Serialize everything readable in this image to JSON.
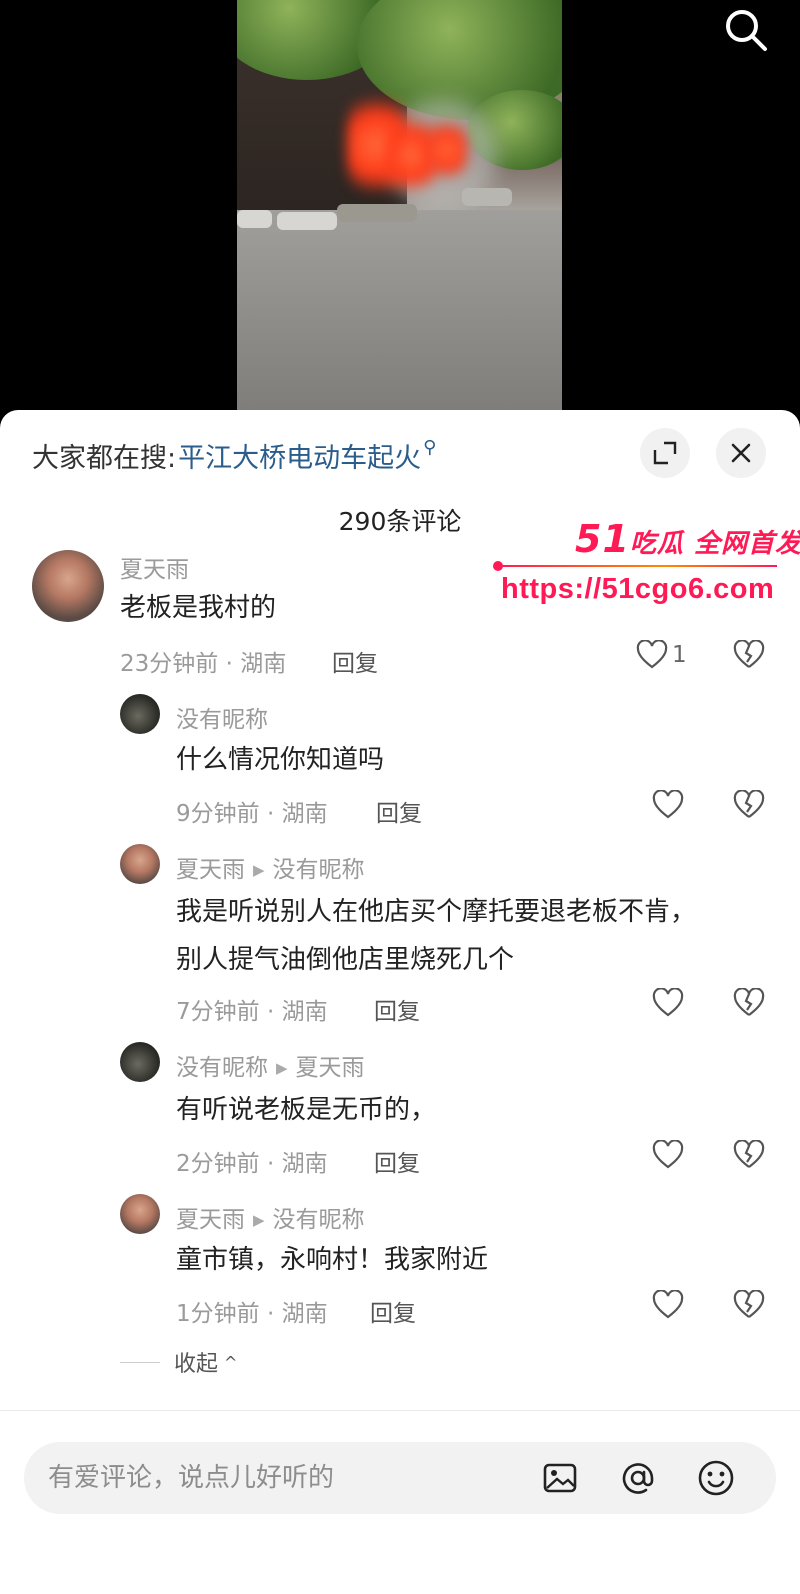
{
  "video": {
    "search_icon": "search-icon"
  },
  "header": {
    "search_prefix": "大家都在搜:",
    "search_term": "平江大桥电动车起火",
    "expand_icon": "expand-icon",
    "close_icon": "close-icon"
  },
  "comment_count": "290条评论",
  "comments": [
    {
      "name": "夏天雨",
      "text": "老板是我村的",
      "time_location": "23分钟前 · 湖南",
      "reply": "回复",
      "likes": "1"
    }
  ],
  "replies": [
    {
      "name": "没有昵称",
      "reply_to": "",
      "lines": [
        "什么情况你知道吗"
      ],
      "time_location": "9分钟前 · 湖南",
      "reply": "回复"
    },
    {
      "name": "夏天雨",
      "reply_to": "没有昵称",
      "lines": [
        "我是听说别人在他店买个摩托要退老板不肯，",
        "别人提气油倒他店里烧死几个"
      ],
      "time_location": "7分钟前 · 湖南",
      "reply": "回复"
    },
    {
      "name": "没有昵称",
      "reply_to": "夏天雨",
      "lines": [
        "有听说老板是无币的，"
      ],
      "time_location": "2分钟前 · 湖南",
      "reply": "回复"
    },
    {
      "name": "夏天雨",
      "reply_to": "没有昵称",
      "lines": [
        "童市镇，永响村！我家附近"
      ],
      "time_location": "1分钟前 · 湖南",
      "reply": "回复"
    }
  ],
  "collapse_label": "收起",
  "input": {
    "placeholder": "有爱评论，说点儿好听的"
  },
  "watermark": {
    "num": "51",
    "tagline": "吃瓜 全网首发",
    "url": "https://51cgo6.com"
  },
  "colors": {
    "link": "#2b5d8c",
    "watermark": "#ff1a56"
  }
}
